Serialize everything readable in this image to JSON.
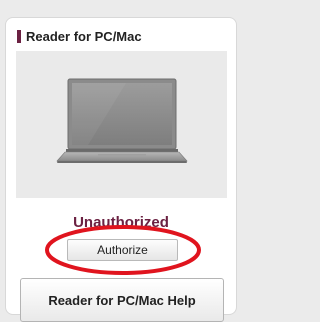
{
  "card": {
    "title": "Reader for PC/Mac",
    "image_icon": "laptop-icon",
    "status": "Unauthorized",
    "authorize_label": "Authorize",
    "help_label": "Reader for PC/Mac Help"
  },
  "colors": {
    "accent": "#6b2142",
    "highlight": "#e0141e",
    "card_background": "#ffffff",
    "page_background": "#ebebeb"
  }
}
